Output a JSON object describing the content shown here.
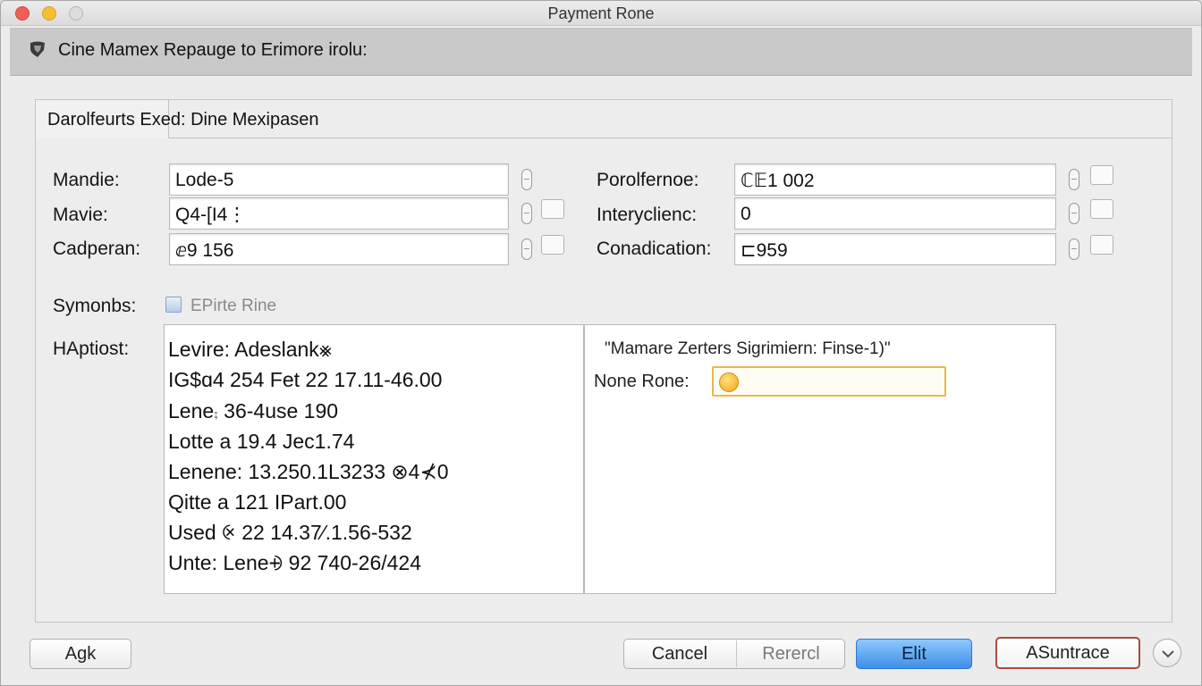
{
  "window": {
    "title": "Payment Rone"
  },
  "header": {
    "text": "Cine Mamex Repauge to Erimore irolu:"
  },
  "tab": {
    "label": "Darolfeurts",
    "heading": "Exed: Dine Mexipasen"
  },
  "form_left": [
    {
      "label": "Mandie:",
      "value": "Lode-5"
    },
    {
      "label": "Mavie:",
      "value": "Q4-[I4⋮"
    },
    {
      "label": "Cadperan:",
      "value": "ⅇ9 156"
    }
  ],
  "form_right": [
    {
      "label": "Porolfernoe:",
      "value": "ℂ𝔼1 002"
    },
    {
      "label": "Interyclienc:",
      "value": "0"
    },
    {
      "label": "Conadication:",
      "value": "⊏959"
    }
  ],
  "options": {
    "label": "Symonbs:",
    "checkbox_label": "EPirte Rine"
  },
  "history": {
    "label": "HAptiost:",
    "lines": [
      "Levire: Adeslank⨳",
      "IG$ɑ4 254 Fet 22 17.11-46.00",
      "Lene⨾ 36-4use 190",
      "Lotte a 19.4 Jec1.74",
      "Lenene: 13.250.1L3233 ⊗4⊀0",
      "Qitte a 121 IPart.00",
      "Used ⨴ 22 14.37⁄.1.56-532",
      "Unte: Lene⨮ 92 740-26/424"
    ]
  },
  "details": {
    "note": "\"Mamare Zerters Sigrimiern: Finse-1)\"",
    "field_label": "None Rone:"
  },
  "buttons": {
    "left": "Agk",
    "cancel": "Cancel",
    "reset": "Rerercl",
    "primary": "Elit",
    "secondary": "ASuntrace"
  },
  "colors": {
    "primary": "#3e8fe8",
    "accent_border": "#e8b84a",
    "secondary_border": "#a84b3c"
  }
}
